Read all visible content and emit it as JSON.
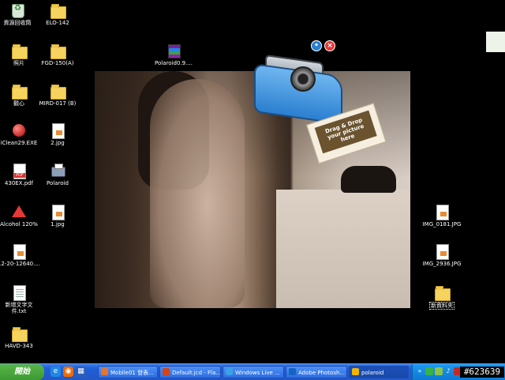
{
  "desktop": {
    "icons": [
      {
        "label": "資源回收筒",
        "icon": "recycle-bin-icon"
      },
      {
        "label": "照片",
        "icon": "folder-icon"
      },
      {
        "label": "觀心",
        "icon": "folder-icon"
      },
      {
        "label": "iClean29.EXE",
        "icon": "app-icon"
      },
      {
        "label": "430EX.pdf",
        "icon": "pdf-icon"
      },
      {
        "label": "Alcohol 120%",
        "icon": "alcohol-icon"
      },
      {
        "label": "12-20-12640....",
        "icon": "image-file-icon"
      },
      {
        "label": "新增文字文件.txt",
        "icon": "text-file-icon"
      },
      {
        "label": "HAVD-343",
        "icon": "folder-icon"
      },
      {
        "label": "ELO-142",
        "icon": "folder-icon"
      },
      {
        "label": "FGD-150(A)",
        "icon": "folder-icon"
      },
      {
        "label": "MIRD-017 (B)",
        "icon": "folder-icon"
      },
      {
        "label": "2.jpg",
        "icon": "image-file-icon"
      },
      {
        "label": "Polaroid",
        "icon": "printer-icon"
      },
      {
        "label": "1.jpg",
        "icon": "image-file-icon"
      },
      {
        "label": "Polaroid0.9....",
        "icon": "winrar-icon"
      },
      {
        "label": "IMG_0181.JPG",
        "icon": "image-file-icon"
      },
      {
        "label": "IMG_2936.JPG",
        "icon": "image-file-icon"
      },
      {
        "label": "新資料夾",
        "icon": "folder-icon"
      }
    ]
  },
  "polaroid_widget": {
    "photo_text": "Drag & Drop your picture here"
  },
  "taskbar": {
    "start_label": "開始",
    "tasks": [
      {
        "label": "Mobile01 發表...",
        "icon_color": "#e8742f"
      },
      {
        "label": "Default.jcd - Fla...",
        "icon_color": "#d84315"
      },
      {
        "label": "Windows Live ...",
        "icon_color": "#3aa0e8"
      },
      {
        "label": "Adobe Photosh...",
        "icon_color": "#1565c0"
      },
      {
        "label": "polaroid",
        "icon_color": "#f4b400"
      }
    ]
  },
  "watermark": {
    "text": "#623639"
  },
  "colors": {
    "taskbar": "#2457c7",
    "start": "#3d9a34",
    "tray": "#0e79d4"
  }
}
